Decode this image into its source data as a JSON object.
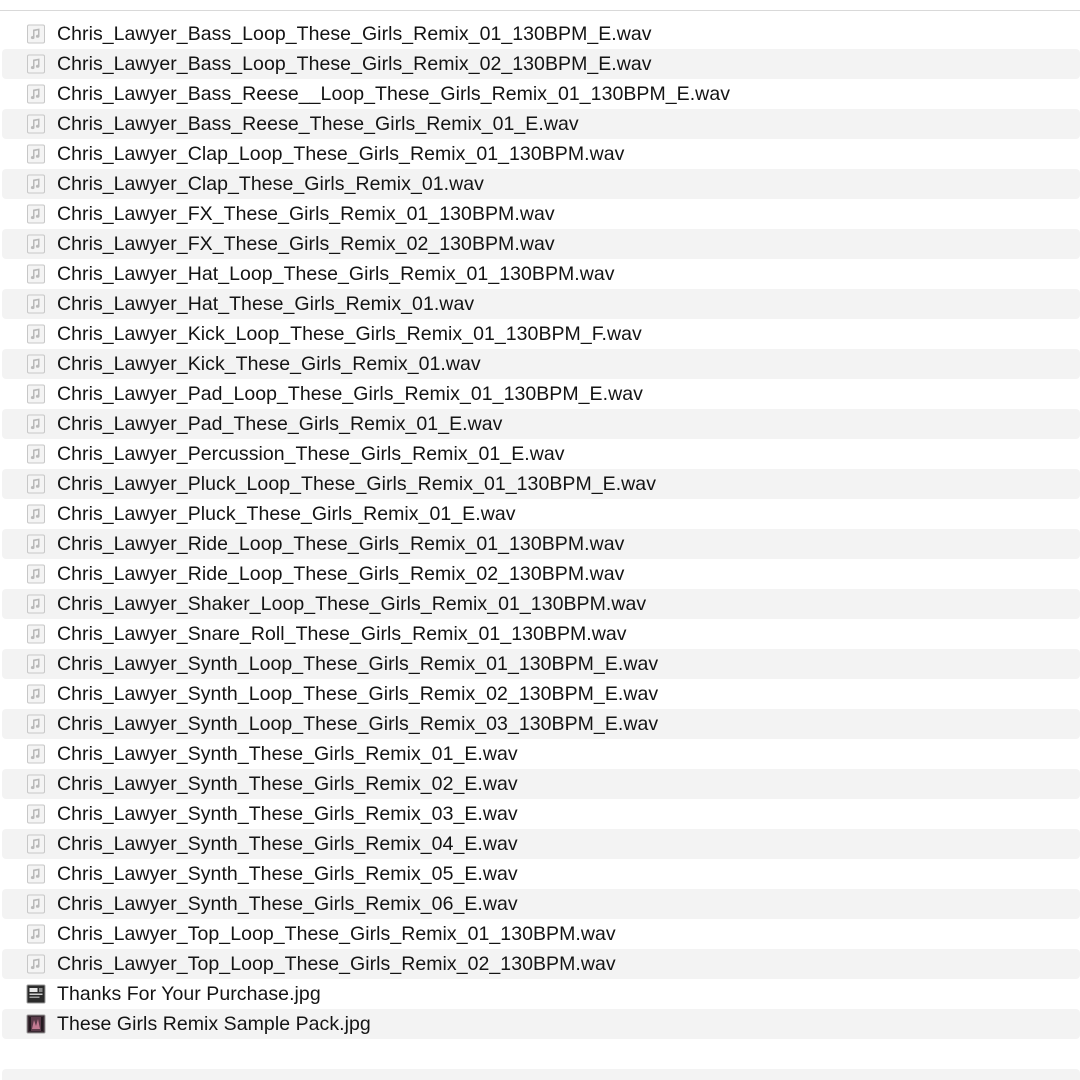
{
  "colors": {
    "row_alt": "#f3f3f3",
    "text": "#141414",
    "divider": "#d9d9d9"
  },
  "files": [
    {
      "name": "Chris_Lawyer_Bass_Loop_These_Girls_Remix_01_130BPM_E.wav",
      "icon": "audio-file-icon"
    },
    {
      "name": "Chris_Lawyer_Bass_Loop_These_Girls_Remix_02_130BPM_E.wav",
      "icon": "audio-file-icon"
    },
    {
      "name": "Chris_Lawyer_Bass_Reese__Loop_These_Girls_Remix_01_130BPM_E.wav",
      "icon": "audio-file-icon"
    },
    {
      "name": "Chris_Lawyer_Bass_Reese_These_Girls_Remix_01_E.wav",
      "icon": "audio-file-icon"
    },
    {
      "name": "Chris_Lawyer_Clap_Loop_These_Girls_Remix_01_130BPM.wav",
      "icon": "audio-file-icon"
    },
    {
      "name": "Chris_Lawyer_Clap_These_Girls_Remix_01.wav",
      "icon": "audio-file-icon"
    },
    {
      "name": "Chris_Lawyer_FX_These_Girls_Remix_01_130BPM.wav",
      "icon": "audio-file-icon"
    },
    {
      "name": "Chris_Lawyer_FX_These_Girls_Remix_02_130BPM.wav",
      "icon": "audio-file-icon"
    },
    {
      "name": "Chris_Lawyer_Hat_Loop_These_Girls_Remix_01_130BPM.wav",
      "icon": "audio-file-icon"
    },
    {
      "name": "Chris_Lawyer_Hat_These_Girls_Remix_01.wav",
      "icon": "audio-file-icon"
    },
    {
      "name": "Chris_Lawyer_Kick_Loop_These_Girls_Remix_01_130BPM_F.wav",
      "icon": "audio-file-icon"
    },
    {
      "name": "Chris_Lawyer_Kick_These_Girls_Remix_01.wav",
      "icon": "audio-file-icon"
    },
    {
      "name": "Chris_Lawyer_Pad_Loop_These_Girls_Remix_01_130BPM_E.wav",
      "icon": "audio-file-icon"
    },
    {
      "name": "Chris_Lawyer_Pad_These_Girls_Remix_01_E.wav",
      "icon": "audio-file-icon"
    },
    {
      "name": "Chris_Lawyer_Percussion_These_Girls_Remix_01_E.wav",
      "icon": "audio-file-icon"
    },
    {
      "name": "Chris_Lawyer_Pluck_Loop_These_Girls_Remix_01_130BPM_E.wav",
      "icon": "audio-file-icon"
    },
    {
      "name": "Chris_Lawyer_Pluck_These_Girls_Remix_01_E.wav",
      "icon": "audio-file-icon"
    },
    {
      "name": "Chris_Lawyer_Ride_Loop_These_Girls_Remix_01_130BPM.wav",
      "icon": "audio-file-icon"
    },
    {
      "name": "Chris_Lawyer_Ride_Loop_These_Girls_Remix_02_130BPM.wav",
      "icon": "audio-file-icon"
    },
    {
      "name": "Chris_Lawyer_Shaker_Loop_These_Girls_Remix_01_130BPM.wav",
      "icon": "audio-file-icon"
    },
    {
      "name": "Chris_Lawyer_Snare_Roll_These_Girls_Remix_01_130BPM.wav",
      "icon": "audio-file-icon"
    },
    {
      "name": "Chris_Lawyer_Synth_Loop_These_Girls_Remix_01_130BPM_E.wav",
      "icon": "audio-file-icon"
    },
    {
      "name": "Chris_Lawyer_Synth_Loop_These_Girls_Remix_02_130BPM_E.wav",
      "icon": "audio-file-icon"
    },
    {
      "name": "Chris_Lawyer_Synth_Loop_These_Girls_Remix_03_130BPM_E.wav",
      "icon": "audio-file-icon"
    },
    {
      "name": "Chris_Lawyer_Synth_These_Girls_Remix_01_E.wav",
      "icon": "audio-file-icon"
    },
    {
      "name": "Chris_Lawyer_Synth_These_Girls_Remix_02_E.wav",
      "icon": "audio-file-icon"
    },
    {
      "name": "Chris_Lawyer_Synth_These_Girls_Remix_03_E.wav",
      "icon": "audio-file-icon"
    },
    {
      "name": "Chris_Lawyer_Synth_These_Girls_Remix_04_E.wav",
      "icon": "audio-file-icon"
    },
    {
      "name": "Chris_Lawyer_Synth_These_Girls_Remix_05_E.wav",
      "icon": "audio-file-icon"
    },
    {
      "name": "Chris_Lawyer_Synth_These_Girls_Remix_06_E.wav",
      "icon": "audio-file-icon"
    },
    {
      "name": "Chris_Lawyer_Top_Loop_These_Girls_Remix_01_130BPM.wav",
      "icon": "audio-file-icon"
    },
    {
      "name": "Chris_Lawyer_Top_Loop_These_Girls_Remix_02_130BPM.wav",
      "icon": "audio-file-icon"
    },
    {
      "name": "Thanks For Your Purchase.jpg",
      "icon": "image-thumbnail-icon"
    },
    {
      "name": "These Girls Remix Sample Pack.jpg",
      "icon": "cover-art-thumbnail-icon"
    }
  ]
}
